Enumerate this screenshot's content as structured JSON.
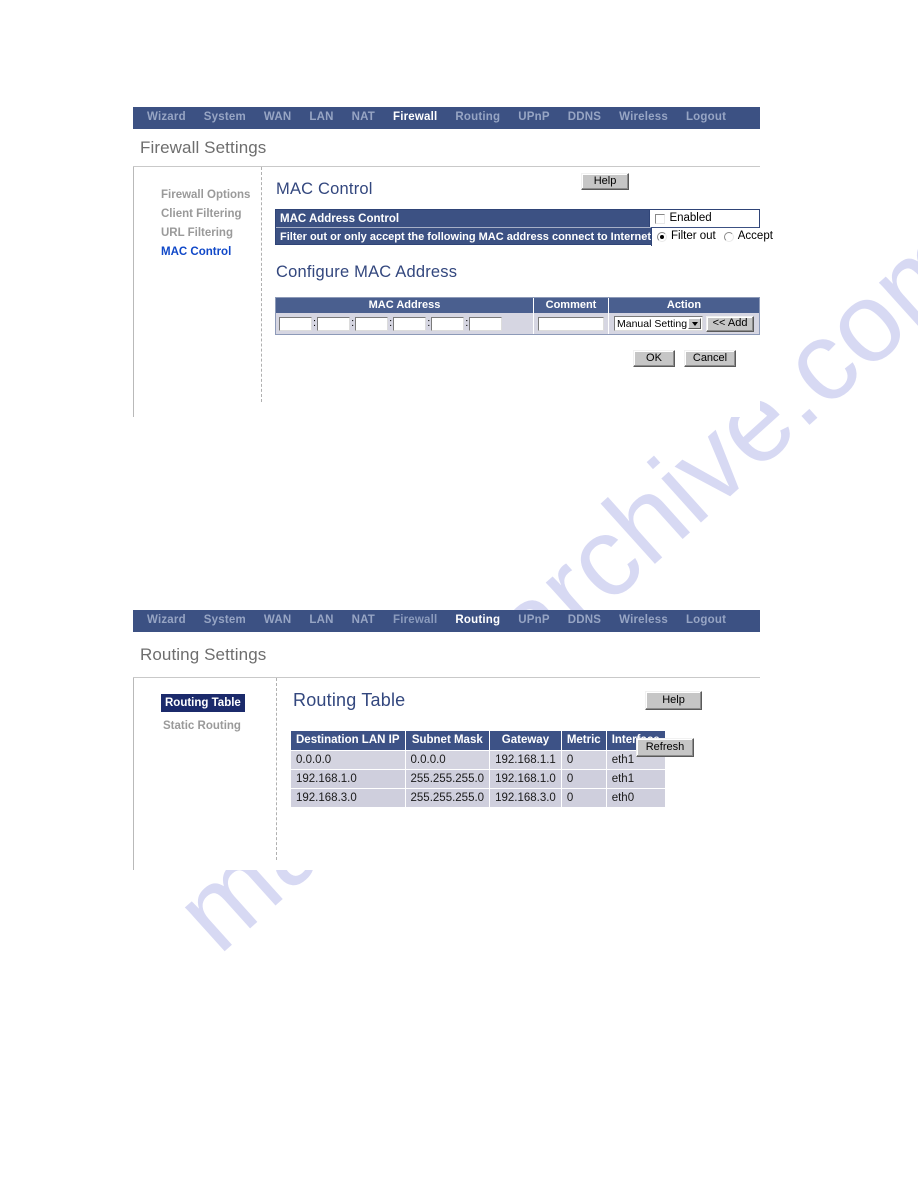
{
  "watermark": {
    "text": "manualsarchive.com"
  },
  "panel_firewall": {
    "nav": [
      {
        "label": "Wizard",
        "active": false
      },
      {
        "label": "System",
        "active": false
      },
      {
        "label": "WAN",
        "active": false
      },
      {
        "label": "LAN",
        "active": false
      },
      {
        "label": "NAT",
        "active": false
      },
      {
        "label": "Firewall",
        "active": true
      },
      {
        "label": "Routing",
        "active": false
      },
      {
        "label": "UPnP",
        "active": false
      },
      {
        "label": "DDNS",
        "active": false
      },
      {
        "label": "Wireless",
        "active": false
      },
      {
        "label": "Logout",
        "active": false
      }
    ],
    "page_title": "Firewall Settings",
    "sidebar": [
      {
        "label": "Firewall Options",
        "active": false
      },
      {
        "label": "Client Filtering",
        "active": false
      },
      {
        "label": "URL Filtering",
        "active": false
      },
      {
        "label": "MAC Control",
        "active": true
      }
    ],
    "section_title": "MAC Control",
    "help_label": "Help",
    "mac_control": {
      "title": "MAC Address Control",
      "description": "Filter out or only accept  the following MAC address  connect to Internet.",
      "enabled_label": "Enabled",
      "enabled_checked": false,
      "mode_filter_label": "Filter out",
      "mode_accept_label": "Accept",
      "mode_selected": "Filter out"
    },
    "configure_title": "Configure MAC Address",
    "configure_table": {
      "headers": [
        "MAC Address",
        "Comment",
        "Action"
      ],
      "mac_octets": [
        "",
        "",
        "",
        "",
        "",
        ""
      ],
      "octet_separator": ":",
      "comment_value": "",
      "action_select_value": "Manual Setting",
      "add_button_label": "<< Add"
    },
    "ok_label": "OK",
    "cancel_label": "Cancel"
  },
  "panel_routing": {
    "nav": [
      {
        "label": "Wizard",
        "active": false
      },
      {
        "label": "System",
        "active": false
      },
      {
        "label": "WAN",
        "active": false
      },
      {
        "label": "LAN",
        "active": false
      },
      {
        "label": "NAT",
        "active": false
      },
      {
        "label": "Firewall",
        "active": false
      },
      {
        "label": "Routing",
        "active": true
      },
      {
        "label": "UPnP",
        "active": false
      },
      {
        "label": "DDNS",
        "active": false
      },
      {
        "label": "Wireless",
        "active": false
      },
      {
        "label": "Logout",
        "active": false
      }
    ],
    "page_title": "Routing Settings",
    "sidebar": [
      {
        "label": "Routing Table",
        "active": true
      },
      {
        "label": "Static Routing",
        "active": false
      }
    ],
    "section_title": "Routing Table",
    "help_label": "Help",
    "refresh_label": "Refresh",
    "table": {
      "headers": [
        "Destination LAN IP",
        "Subnet Mask",
        "Gateway",
        "Metric",
        "Interface"
      ],
      "rows": [
        [
          "0.0.0.0",
          "0.0.0.0",
          "192.168.1.1",
          "0",
          "eth1"
        ],
        [
          "192.168.1.0",
          "255.255.255.0",
          "192.168.1.0",
          "0",
          "eth1"
        ],
        [
          "192.168.3.0",
          "255.255.255.0",
          "192.168.3.0",
          "0",
          "eth0"
        ]
      ]
    }
  },
  "colors": {
    "nav_bg": "#3c5183",
    "nav_active": "#ffffff",
    "nav_inactive": "#97a5c4",
    "heading": "#33477e",
    "sidebar_link_active": "#1048c8",
    "sidebar_block_active_bg": "#1b2a6b",
    "table_header_bg": "#3d5286",
    "table_cell_bg": "#d4d4e0",
    "watermark": "#c9cbef"
  }
}
